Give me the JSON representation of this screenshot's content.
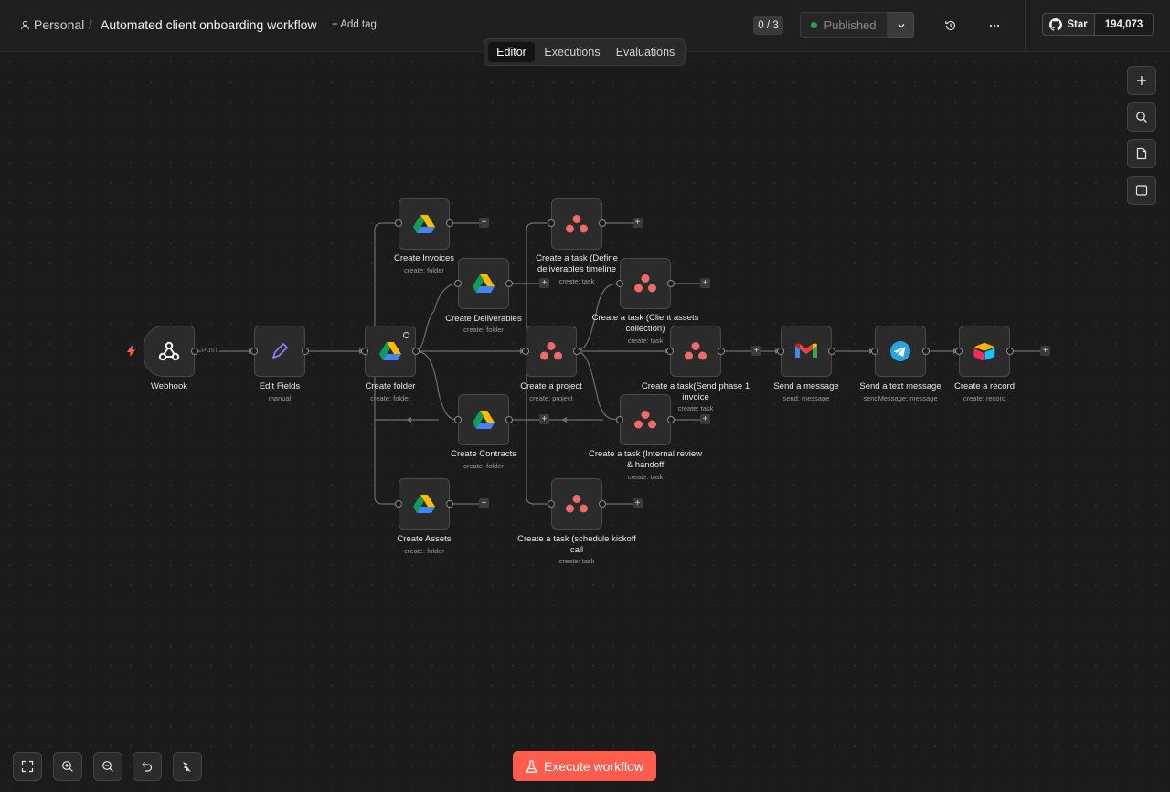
{
  "header": {
    "project": "Personal",
    "separator": "/",
    "workflow_title": "Automated client onboarding workflow",
    "add_tag": "+ Add tag",
    "counter": "0 / 3",
    "published_label": "Published",
    "github_star": "Star",
    "github_count": "194,073"
  },
  "tabs": [
    {
      "label": "Editor",
      "active": true
    },
    {
      "label": "Executions",
      "active": false
    },
    {
      "label": "Evaluations",
      "active": false
    }
  ],
  "nodes": [
    {
      "id": "webhook",
      "label": "Webhook",
      "sub": "",
      "icon": "webhook-icon"
    },
    {
      "id": "edit",
      "label": "Edit Fields",
      "sub": "manual",
      "icon": "pencil-icon"
    },
    {
      "id": "folder",
      "label": "Create folder",
      "sub": "create: folder",
      "icon": "google-drive-icon"
    },
    {
      "id": "invoices",
      "label": "Create Invoices",
      "sub": "create: folder",
      "icon": "google-drive-icon"
    },
    {
      "id": "deliverables",
      "label": "Create Deliverables",
      "sub": "create: folder",
      "icon": "google-drive-icon"
    },
    {
      "id": "contracts",
      "label": "Create Contracts",
      "sub": "create: folder",
      "icon": "google-drive-icon"
    },
    {
      "id": "assets",
      "label": "Create Assets",
      "sub": "create: folder",
      "icon": "google-drive-icon"
    },
    {
      "id": "task_define",
      "label": "Create a task (Define deliverables timeline",
      "sub": "create: task",
      "icon": "asana-icon"
    },
    {
      "id": "task_client",
      "label": "Create a task (Client assets collection)",
      "sub": "create: task",
      "icon": "asana-icon"
    },
    {
      "id": "project",
      "label": "Create a project",
      "sub": "create: project",
      "icon": "asana-icon"
    },
    {
      "id": "task_send",
      "label": "Create a task(Send phase 1 invoice",
      "sub": "create: task",
      "icon": "asana-icon"
    },
    {
      "id": "task_internal",
      "label": "Create a task (Internal review & handoff",
      "sub": "create: task",
      "icon": "asana-icon"
    },
    {
      "id": "task_kickoff",
      "label": "Create a task (schedule kickoff call",
      "sub": "create: task",
      "icon": "asana-icon"
    },
    {
      "id": "gmail",
      "label": "Send a message",
      "sub": "send: message",
      "icon": "gmail-icon"
    },
    {
      "id": "telegram",
      "label": "Send a text message",
      "sub": "sendMessage: message",
      "icon": "telegram-icon"
    },
    {
      "id": "airtable",
      "label": "Create a record",
      "sub": "create: record",
      "icon": "airtable-icon"
    }
  ],
  "edges": {
    "webhook_label": "POST"
  },
  "footer": {
    "execute_label": "Execute workflow"
  },
  "colors": {
    "accent": "#ff5c4d",
    "published_dot": "#2e9e57",
    "background": "#1b1b1b"
  }
}
